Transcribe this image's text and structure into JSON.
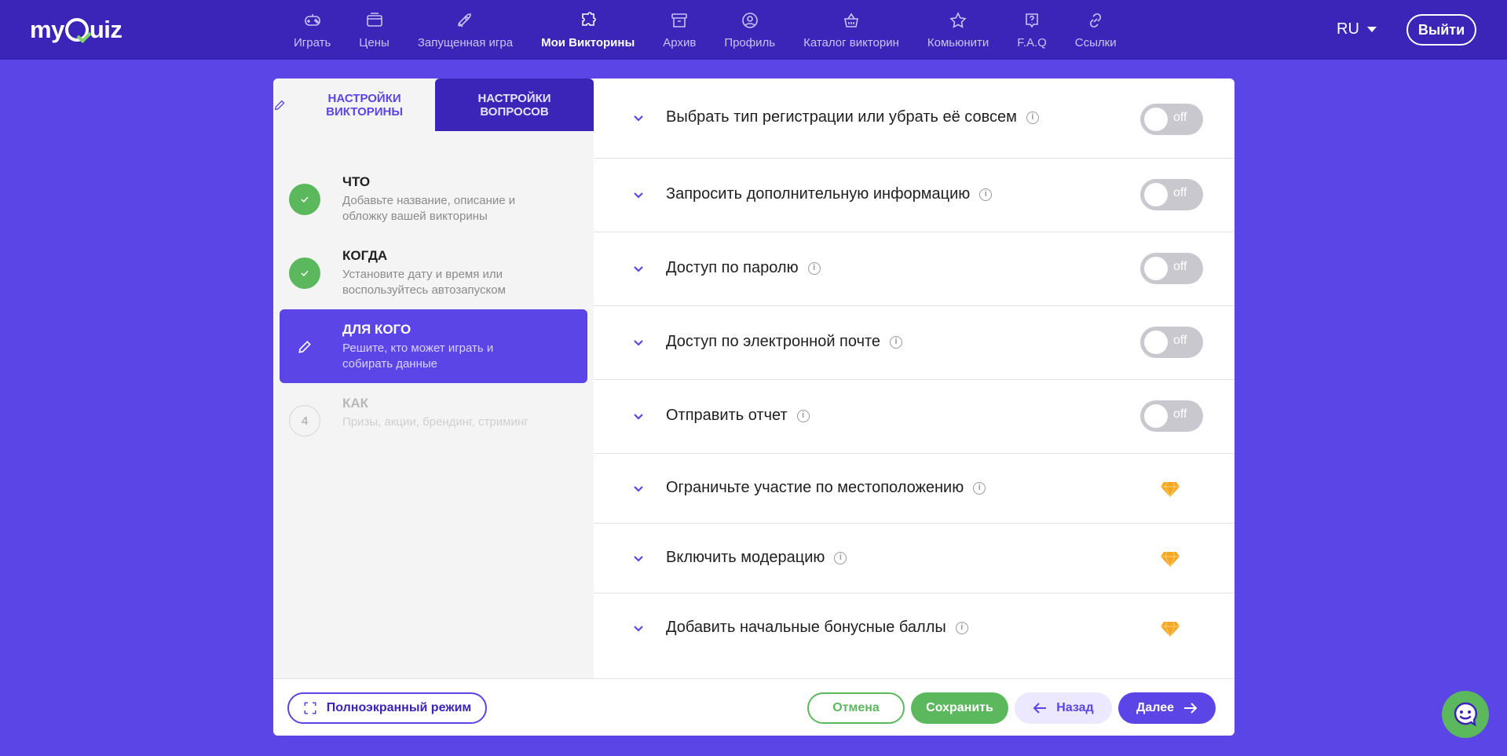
{
  "app": {
    "logo": "myQuiz"
  },
  "nav": {
    "items": [
      {
        "label": "Играть",
        "icon": "gamepad-icon"
      },
      {
        "label": "Цены",
        "icon": "wallet-icon"
      },
      {
        "label": "Запущенная игра",
        "icon": "rocket-icon"
      },
      {
        "label": "Мои Викторины",
        "icon": "puzzle-icon",
        "active": true
      },
      {
        "label": "Архив",
        "icon": "archive-icon"
      },
      {
        "label": "Профиль",
        "icon": "user-icon"
      },
      {
        "label": "Каталог викторин",
        "icon": "basket-icon"
      },
      {
        "label": "Комьюнити",
        "icon": "star-icon"
      },
      {
        "label": "F.A.Q",
        "icon": "question-icon"
      },
      {
        "label": "Ссылки",
        "icon": "link-icon"
      }
    ],
    "language": "RU",
    "logout": "Выйти"
  },
  "tabs": {
    "quiz_settings": "Настройки викторины",
    "question_settings": "Настройки вопросов"
  },
  "steps": [
    {
      "title": "ЧТО",
      "desc": "Добавьте название, описание и обложку вашей викторины",
      "state": "done"
    },
    {
      "title": "КОГДА",
      "desc": "Установите дату и время или воспользуйтесь автозапуском",
      "state": "done"
    },
    {
      "title": "ДЛЯ КОГО",
      "desc": "Решите, кто может играть и собирать данные",
      "state": "active"
    },
    {
      "title": "КАК",
      "desc": "Призы, акции, брендинг, стриминг",
      "state": "todo",
      "number": "4"
    }
  ],
  "settings": [
    {
      "label": "Выбрать тип регистрации или убрать её совсем",
      "type": "toggle",
      "value": "off"
    },
    {
      "label": "Запросить дополнительную информацию",
      "type": "toggle",
      "value": "off"
    },
    {
      "label": "Доступ по паролю",
      "type": "toggle",
      "value": "off"
    },
    {
      "label": "Доступ по электронной почте",
      "type": "toggle",
      "value": "off"
    },
    {
      "label": "Отправить отчет",
      "type": "toggle",
      "value": "off"
    },
    {
      "label": "Ограничьте участие по местоположению",
      "type": "premium"
    },
    {
      "label": "Включить модерацию",
      "type": "premium"
    },
    {
      "label": "Добавить начальные бонусные баллы",
      "type": "premium"
    }
  ],
  "footer": {
    "fullscreen": "Полноэкранный режим",
    "cancel": "Отмена",
    "save": "Сохранить",
    "back": "Назад",
    "next": "Далее"
  },
  "colors": {
    "primary": "#5b45e6",
    "nav_bg": "#3b25b8",
    "success": "#5cb85c",
    "premium": "#f5a623"
  }
}
